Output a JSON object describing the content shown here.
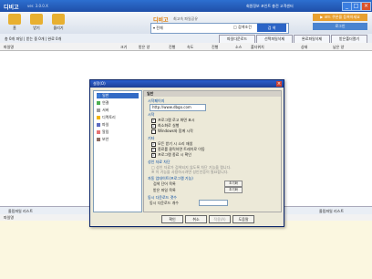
{
  "app": {
    "title": "디비고",
    "version": "ver. 3.0.0.X",
    "links": "회원정보  포인트  충전  고객센터"
  },
  "toolbar": {
    "buttons": [
      {
        "label": "홈",
        "color": "#e8b030"
      },
      {
        "label": "받기",
        "color": "#e8b030"
      },
      {
        "label": "올리기",
        "color": "#e8b030"
      }
    ]
  },
  "logo": {
    "name": "디비고",
    "tagline": "최고속 파일공유"
  },
  "search": {
    "category": "▾ 전체",
    "option": "□ 검색조건",
    "button": "검 색",
    "placeholder": ""
  },
  "promo": {
    "top": "▶ 코드 쿠폰을 등록하세요",
    "bottom": "로그인"
  },
  "infobar": {
    "text": "총 0개 파일 | 받는 중 0개 | 완료 0개"
  },
  "tabs": [
    "파일다운로드",
    "선택파일삭제",
    "완료파일삭제",
    "받은폴더열기"
  ],
  "columns": [
    "파일명",
    "크기",
    "받은 양",
    "진행",
    "속도",
    "진행",
    "소스",
    "폴더위치",
    "상태",
    "남은 양"
  ],
  "bottom": {
    "label": "올림파일 리스트",
    "right": "올림파일 리스트"
  },
  "bottom_columns": [
    "파일명"
  ],
  "dialog": {
    "title": "설정(O)",
    "close": "×",
    "tree": [
      {
        "label": "일반",
        "selected": true,
        "color": "#3a7bd5"
      },
      {
        "label": "연결",
        "selected": false,
        "color": "#4caf50"
      },
      {
        "label": "서버",
        "selected": false,
        "color": "#9e9e9e"
      },
      {
        "label": "디렉토리",
        "selected": false,
        "color": "#f0b400"
      },
      {
        "label": "파일",
        "selected": false,
        "color": "#5c6bc0"
      },
      {
        "label": "알림",
        "selected": false,
        "color": "#e57373"
      },
      {
        "label": "보안",
        "selected": false,
        "color": "#8d6e63"
      }
    ],
    "panel_title": "일반",
    "home_section": "시작페이지",
    "home_url": "http://www.dbgo.com",
    "start_section": "시작",
    "start_options": [
      {
        "label": "프로그램 로고 화면 표시",
        "checked": true
      },
      {
        "label": "최소화로 실행",
        "checked": true
      },
      {
        "label": "Windows와 함께 시작",
        "checked": false
      }
    ],
    "misc_section": "기타",
    "misc_options": [
      {
        "label": "모든 받기 시 소리 재생",
        "checked": true
      },
      {
        "label": "종료를 클릭하면 트레이로 이동",
        "checked": true
      },
      {
        "label": "프로그램 종료 시 확인",
        "checked": true
      }
    ],
    "limit_section": "성인 자료 차단",
    "limit_line1": "□ 성인 자료가 검색되지 않도록 차단 기능을 켭니다.",
    "limit_line2": "※ 이 기능을 사용하시려면 성인인증이 필요합니다.",
    "auto_section": "자동 업데이트(프로그램 기능)",
    "auto_row1": "검색 단어 목록",
    "auto_row2": "받은 파일 목록",
    "auto_btn": "초기화",
    "sim_section": "동시 다운로드 갯수",
    "sim_label": "동시 다운로드 개수",
    "buttons": [
      "확인",
      "취소",
      "적용(A)",
      "도움말"
    ]
  }
}
